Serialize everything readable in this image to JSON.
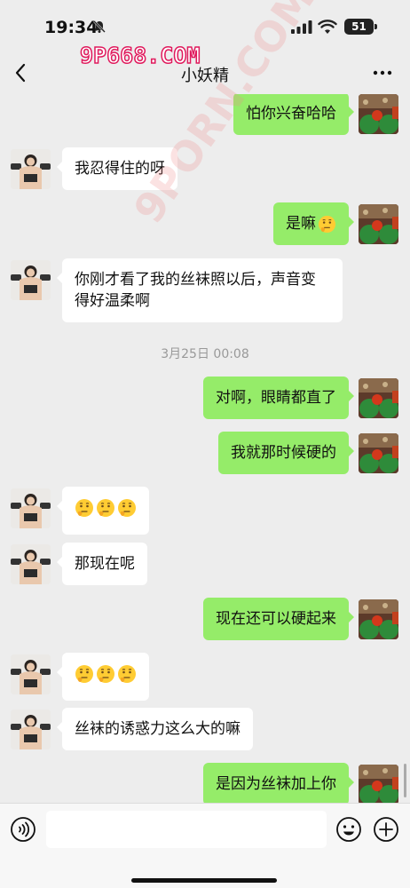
{
  "status_bar": {
    "time": "19:34",
    "battery": "51"
  },
  "header": {
    "title": "小妖精"
  },
  "watermarks": {
    "top": "9P668.COM",
    "diagonal": "9PORN.COM"
  },
  "messages": [
    {
      "side": "right",
      "text": "怕你兴奋哈哈"
    },
    {
      "side": "left",
      "text": "我忍得住的呀"
    },
    {
      "side": "right",
      "text": "是嘛"
    },
    {
      "side": "left",
      "text": "你刚才看了我的丝袜照以后，声音变得好温柔啊"
    },
    {
      "side": "right",
      "text": "对啊，眼睛都直了"
    },
    {
      "side": "right",
      "text": "我就那时候硬的"
    },
    {
      "side": "left",
      "text": ""
    },
    {
      "side": "left",
      "text": "那现在呢"
    },
    {
      "side": "right",
      "text": "现在还可以硬起来"
    },
    {
      "side": "left",
      "text": ""
    },
    {
      "side": "left",
      "text": "丝袜的诱惑力这么大的嘛"
    },
    {
      "side": "right",
      "text": "是因为丝袜加上你"
    }
  ],
  "timestamp": "3月25日 00:08",
  "icons": {
    "back": "chevron-left-icon",
    "more": "more-icon",
    "emoji": "thinking-face-emoji",
    "voice": "voice-icon",
    "sticker": "smiley-icon",
    "plus": "plus-icon"
  },
  "colors": {
    "bubble_self": "#95ec69",
    "bubble_contact": "#ffffff",
    "background": "#ededed"
  },
  "input": {
    "placeholder": ""
  }
}
